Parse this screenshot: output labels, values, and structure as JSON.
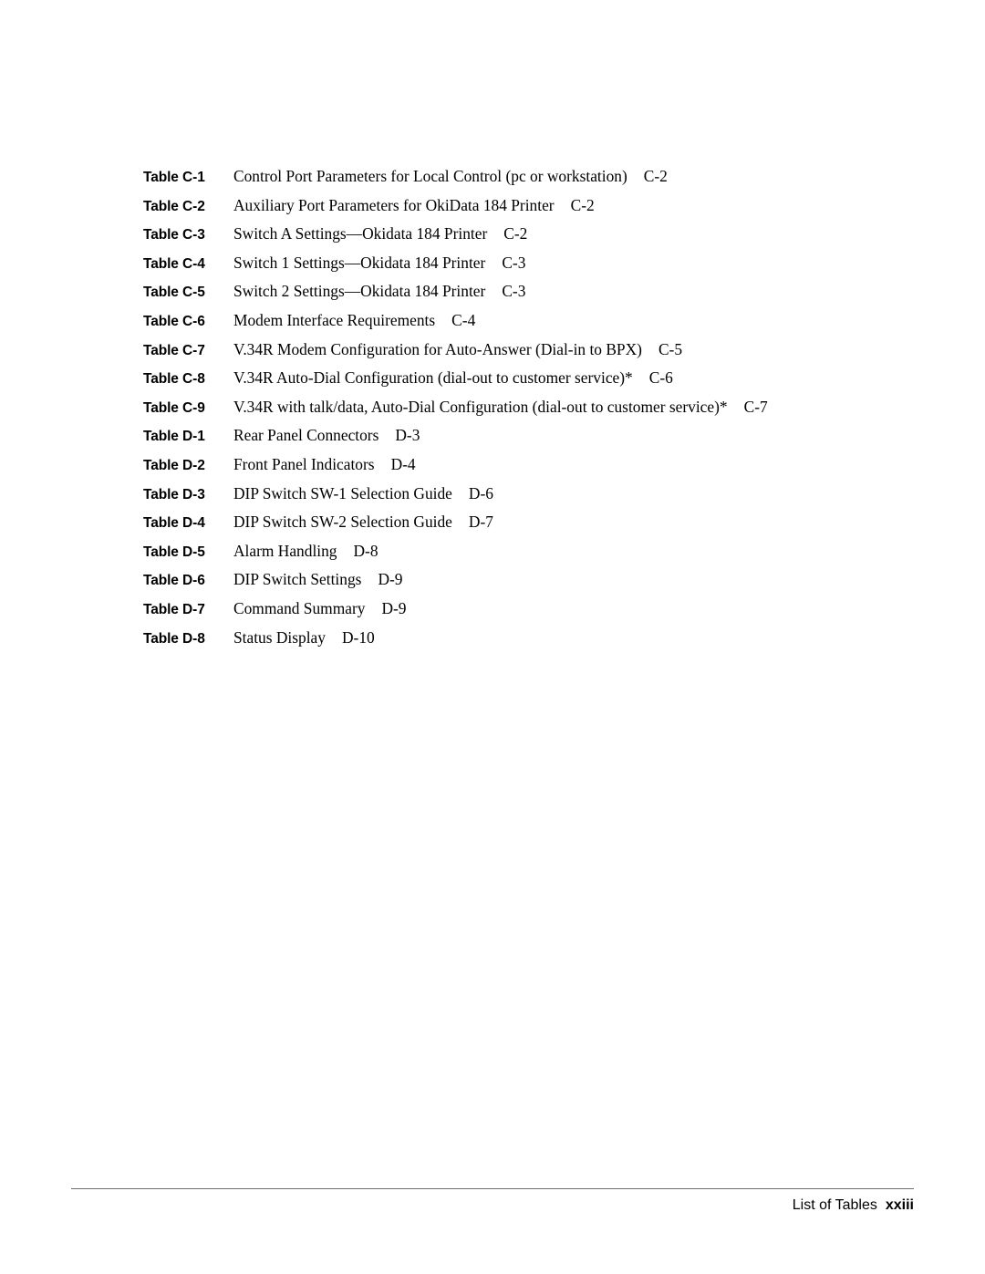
{
  "document": {
    "section_title": "List of Tables",
    "page_number": "xxiii"
  },
  "list_of_tables": {
    "entries": [
      {
        "label": "Table C-1",
        "title": "Control Port Parameters for Local Control (pc or workstation)",
        "page": "C-2"
      },
      {
        "label": "Table C-2",
        "title": "Auxiliary Port Parameters for OkiData 184 Printer",
        "page": "C-2"
      },
      {
        "label": "Table C-3",
        "title": "Switch A Settings—Okidata 184 Printer",
        "page": "C-2"
      },
      {
        "label": "Table C-4",
        "title": "Switch 1 Settings—Okidata 184 Printer",
        "page": "C-3"
      },
      {
        "label": "Table C-5",
        "title": "Switch 2 Settings—Okidata 184 Printer",
        "page": "C-3"
      },
      {
        "label": "Table C-6",
        "title": "Modem Interface Requirements",
        "page": "C-4"
      },
      {
        "label": "Table C-7",
        "title": "V.34R Modem Configuration for Auto-Answer (Dial-in to BPX)",
        "page": "C-5"
      },
      {
        "label": "Table C-8",
        "title": "V.34R Auto-Dial Configuration (dial-out to customer service)*",
        "page": "C-6"
      },
      {
        "label": "Table C-9",
        "title": "V.34R with talk/data, Auto-Dial Configuration (dial-out to customer service)*",
        "page": "C-7"
      },
      {
        "label": "Table D-1",
        "title": "Rear Panel Connectors",
        "page": "D-3"
      },
      {
        "label": "Table D-2",
        "title": "Front Panel Indicators",
        "page": "D-4"
      },
      {
        "label": "Table D-3",
        "title": "DIP Switch SW-1 Selection Guide",
        "page": "D-6"
      },
      {
        "label": "Table D-4",
        "title": "DIP Switch SW-2 Selection Guide",
        "page": "D-7"
      },
      {
        "label": "Table D-5",
        "title": "Alarm Handling",
        "page": "D-8"
      },
      {
        "label": "Table D-6",
        "title": "DIP Switch Settings",
        "page": "D-9"
      },
      {
        "label": "Table D-7",
        "title": "Command Summary",
        "page": "D-9"
      },
      {
        "label": "Table D-8",
        "title": "Status Display",
        "page": "D-10"
      }
    ]
  },
  "footer": {
    "label": "List of Tables",
    "page_number": "xxiii"
  },
  "colors": {
    "background": "#ffffff",
    "text": "#000000",
    "footer_rule": "#6e6e6e"
  }
}
